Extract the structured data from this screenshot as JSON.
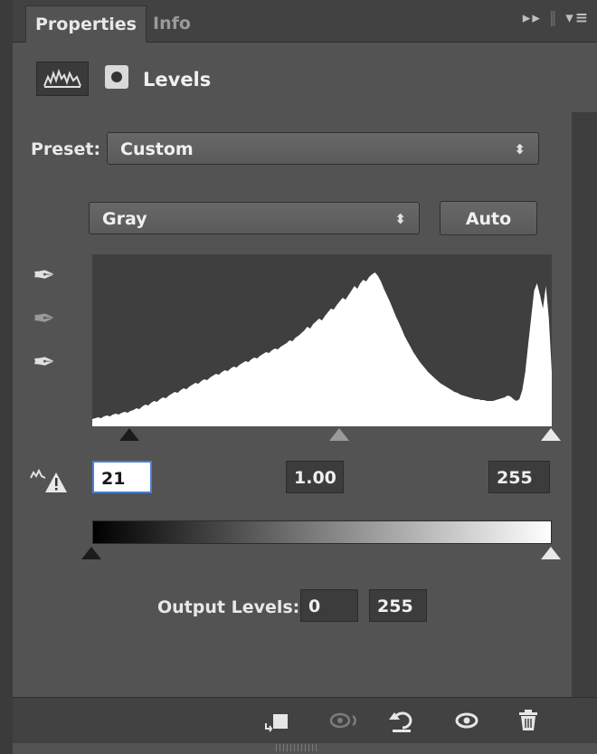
{
  "tabs": [
    {
      "label": "Properties"
    },
    {
      "label": "Info"
    }
  ],
  "panel_controls": {
    "expand": "▸▸",
    "menu": "▾≡"
  },
  "adjustment": {
    "title": "Levels"
  },
  "preset": {
    "label": "Preset:",
    "value": "Custom"
  },
  "channel": {
    "value": "Gray"
  },
  "auto_button": {
    "label": "Auto"
  },
  "input_levels": {
    "black": "21",
    "gamma": "1.00",
    "white": "255"
  },
  "output_levels": {
    "label": "Output Levels:",
    "black": "0",
    "white": "255"
  },
  "histogram": {
    "heights": [
      8,
      9,
      10,
      9,
      11,
      12,
      11,
      13,
      14,
      13,
      15,
      16,
      15,
      17,
      18,
      20,
      19,
      22,
      24,
      23,
      26,
      28,
      27,
      30,
      32,
      31,
      34,
      36,
      38,
      37,
      40,
      42,
      41,
      44,
      46,
      48,
      47,
      50,
      52,
      51,
      54,
      56,
      58,
      57,
      60,
      62,
      61,
      64,
      66,
      65,
      68,
      70,
      72,
      71,
      74,
      76,
      75,
      78,
      80,
      82,
      81,
      84,
      86,
      85,
      88,
      90,
      92,
      95,
      94,
      98,
      100,
      103,
      106,
      110,
      108,
      113,
      116,
      119,
      117,
      122,
      126,
      130,
      129,
      134,
      138,
      142,
      140,
      145,
      150,
      155,
      152,
      158,
      162,
      160,
      165,
      168,
      170,
      166,
      160,
      152,
      145,
      138,
      130,
      122,
      115,
      108,
      100,
      94,
      88,
      82,
      77,
      72,
      68,
      64,
      60,
      57,
      54,
      51,
      48,
      46,
      44,
      42,
      40,
      38,
      37,
      35,
      34,
      33,
      32,
      31,
      30,
      30,
      29,
      29,
      28,
      28,
      28,
      29,
      30,
      31,
      32,
      34,
      33,
      30,
      28,
      30,
      40,
      60,
      90,
      120,
      150,
      158,
      145,
      130,
      155,
      120,
      60
    ]
  },
  "colors": {
    "panel": "#535353",
    "histogram_bg": "#3f3f3f",
    "histogram_fill": "#ffffff",
    "focus": "#4b7fd1"
  },
  "toolbar_icons": [
    "clip-to-layer-icon",
    "view-previous-state-icon",
    "reset-icon",
    "visibility-eye-icon",
    "trash-icon"
  ]
}
